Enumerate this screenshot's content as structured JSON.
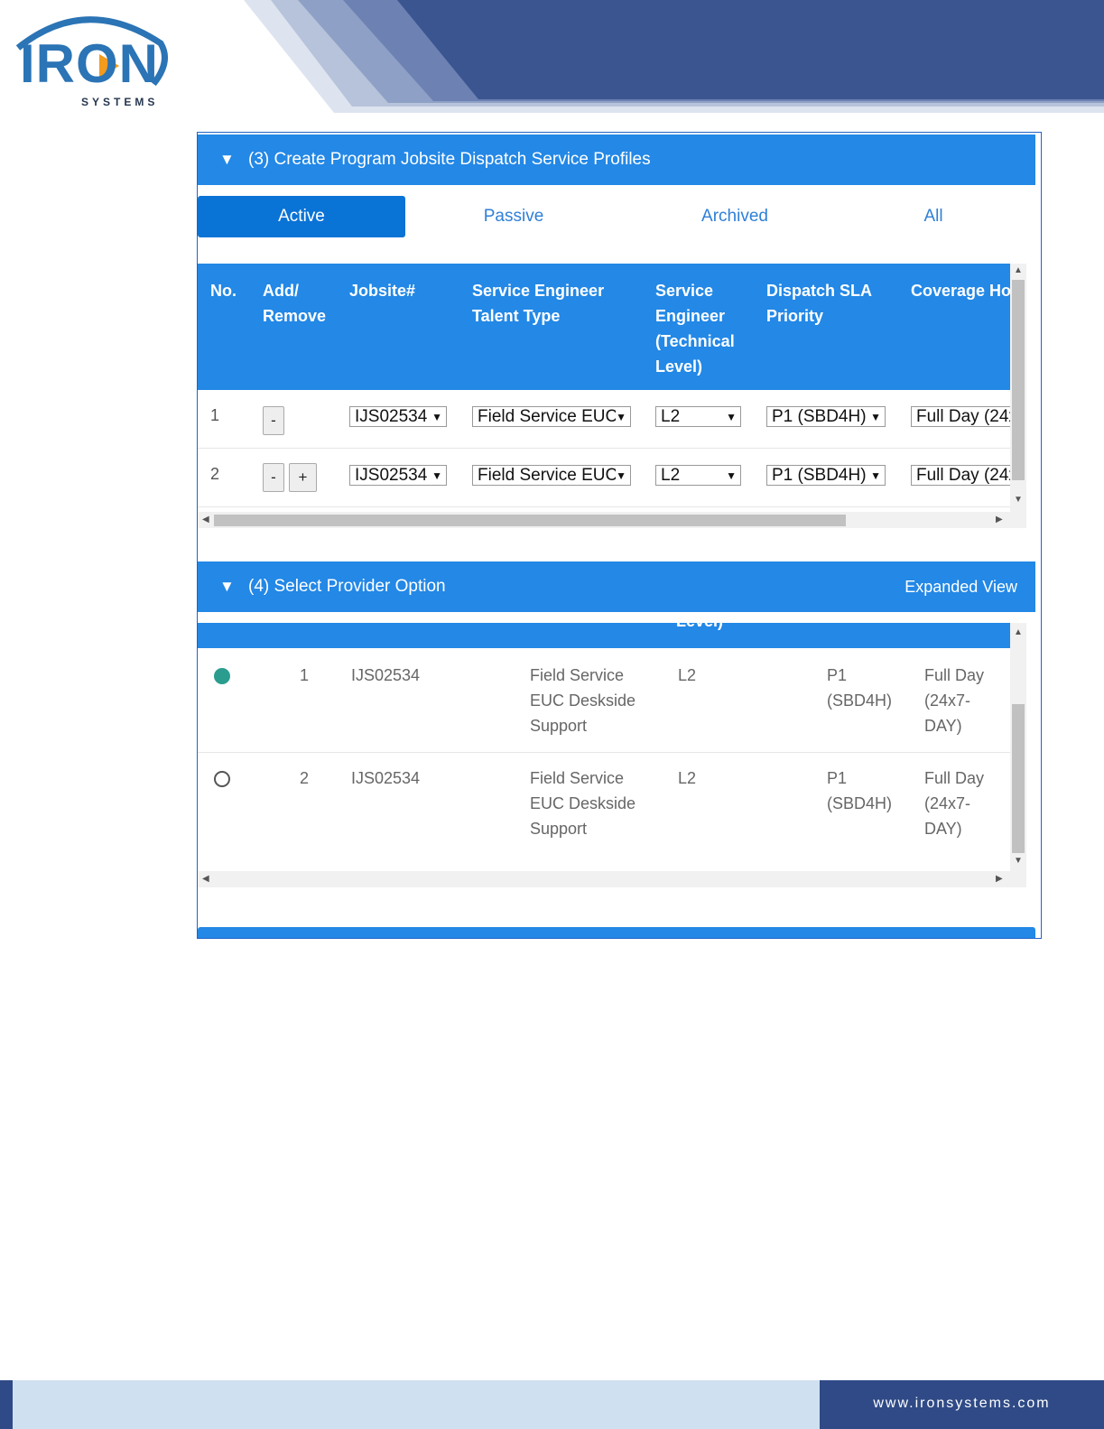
{
  "brand": {
    "logo_main": "IRON",
    "logo_sub": "SYSTEMS",
    "website": "www.ironsystems.com",
    "colors": {
      "primary": "#2388e6",
      "dark_blue": "#2f4a86",
      "light_blue": "#cfe0f0",
      "teal": "#2a9d8f"
    }
  },
  "section3": {
    "title": "(3) Create Program Jobsite Dispatch Service Profiles",
    "tabs": [
      {
        "label": "Active",
        "active": true
      },
      {
        "label": "Passive",
        "active": false
      },
      {
        "label": "Archived",
        "active": false
      },
      {
        "label": "All",
        "active": false
      }
    ],
    "columns": [
      "No.",
      "Add/\nRemove",
      "Jobsite#",
      "Service Engineer\nTalent Type",
      "Service\nEngineer\n(Technical\nLevel)",
      "Dispatch SLA\nPriority",
      "Coverage Ho"
    ],
    "rows": [
      {
        "no": "1",
        "buttons": [
          "-"
        ],
        "jobsite": "IJS02534",
        "talent": "Field Service EUC",
        "level": "L2",
        "priority": "P1 (SBD4H)",
        "coverage": "Full Day (24x"
      },
      {
        "no": "2",
        "buttons": [
          "-",
          "+"
        ],
        "jobsite": "IJS02534",
        "talent": "Field Service EUC",
        "level": "L2",
        "priority": "P1 (SBD4H)",
        "coverage": "Full Day (24x"
      }
    ]
  },
  "section4": {
    "title": "(4) Select Provider Option",
    "expanded_view": "Expanded View",
    "header_fragment": "Level)",
    "rows": [
      {
        "selected": true,
        "no": "1",
        "jobsite": "IJS02534",
        "talent": "Field Service\nEUC Deskside\nSupport",
        "level": "L2",
        "priority": "P1\n(SBD4H)",
        "coverage": "Full Day\n(24x7-\nDAY)"
      },
      {
        "selected": false,
        "no": "2",
        "jobsite": "IJS02534",
        "talent": "Field Service\nEUC Deskside\nSupport",
        "level": "L2",
        "priority": "P1\n(SBD4H)",
        "coverage": "Full Day\n(24x7-\nDAY)"
      }
    ]
  },
  "icons": {
    "collapse": "triangle-down-icon"
  }
}
